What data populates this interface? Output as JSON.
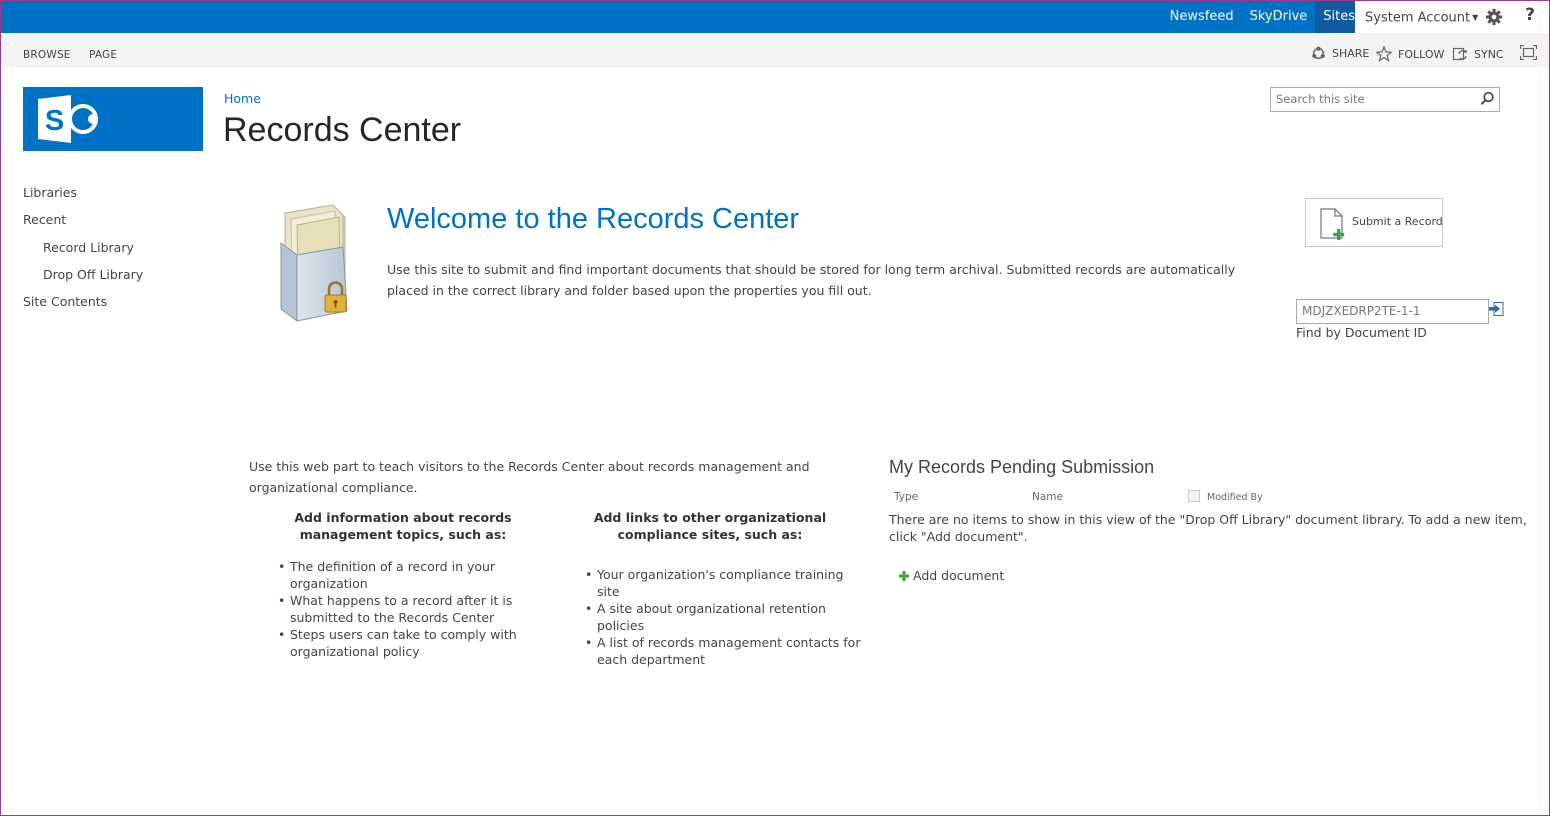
{
  "suite_bar": {
    "links": [
      "Newsfeed",
      "SkyDrive",
      "Sites"
    ],
    "active_link": "Sites",
    "account": "System Account",
    "help": "?"
  },
  "ribbon": {
    "tabs": [
      "BROWSE",
      "PAGE"
    ],
    "actions": {
      "share": "SHARE",
      "follow": "FOLLOW",
      "sync": "SYNC"
    }
  },
  "breadcrumb": {
    "home": "Home"
  },
  "page_title": "Records Center",
  "search": {
    "placeholder": "Search this site"
  },
  "quick_launch": {
    "items": [
      {
        "label": "Libraries",
        "level": 0
      },
      {
        "label": "Recent",
        "level": 0
      },
      {
        "label": "Record Library",
        "level": 1
      },
      {
        "label": "Drop Off Library",
        "level": 1
      },
      {
        "label": "Site Contents",
        "level": 0
      }
    ]
  },
  "welcome": {
    "title": "Welcome to the Records Center",
    "text": "Use this site to submit and find important documents that should be stored for long term archival. Submitted records are automatically placed in the correct library and folder based upon the properties you fill out."
  },
  "submit_record": {
    "label": "Submit a Record"
  },
  "find_by_id": {
    "value": "MDJZXEDRP2TE-1-1",
    "label": "Find by Document ID"
  },
  "info_web_part": {
    "intro": "Use this web part to teach visitors to the Records Center about records management and organizational compliance.",
    "left_column": {
      "heading": "Add information about records management topics, such as:",
      "items": [
        "The definition of a record in your organization",
        "What happens to a record after it is submitted to the Records Center",
        "Steps users can take to comply with organizational policy"
      ]
    },
    "right_column": {
      "heading": "Add links to other organizational compliance sites, such as:",
      "items": [
        "Your organization's compliance training site",
        "A site about organizational retention policies",
        "A list of records management contacts for each department"
      ]
    }
  },
  "pending": {
    "title": "My Records Pending Submission",
    "columns": [
      "Type",
      "Name",
      "Modified By"
    ],
    "empty_message": "There are no items to show in this view of the \"Drop Off Library\" document library. To add a new item, click \"Add document\".",
    "add_label": "Add document"
  },
  "colors": {
    "brand_blue": "#0072c6",
    "text": "#444444",
    "ribbon_bg": "#f3f3f3"
  }
}
